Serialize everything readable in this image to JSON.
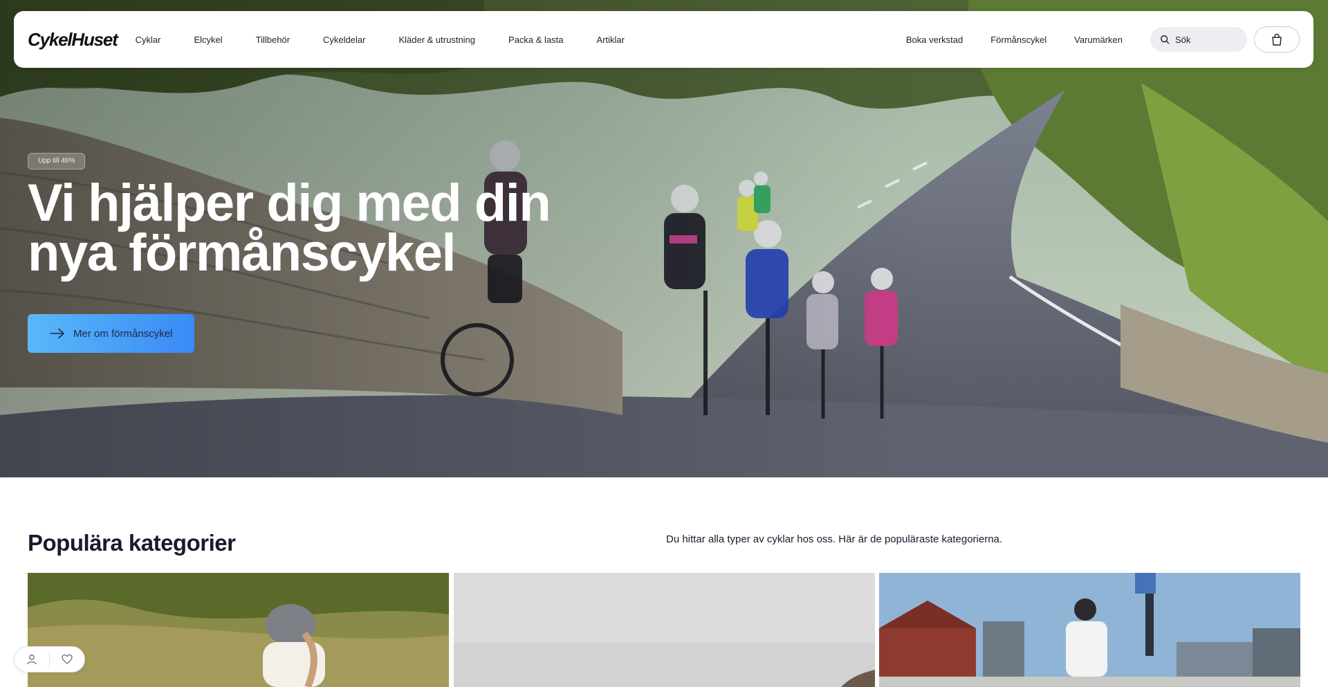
{
  "brand": {
    "logo": "CykelHuset"
  },
  "nav": {
    "main": [
      {
        "label": "Cyklar"
      },
      {
        "label": "Elcykel"
      },
      {
        "label": "Tillbehör"
      },
      {
        "label": "Cykeldelar"
      },
      {
        "label": "Kläder & utrustning"
      },
      {
        "label": "Packa & lasta"
      },
      {
        "label": "Artiklar"
      }
    ],
    "right": [
      {
        "label": "Boka verkstad"
      },
      {
        "label": "Förmånscykel"
      },
      {
        "label": "Varumärken"
      }
    ],
    "search_placeholder": "Sök",
    "icons": {
      "search": "search-icon",
      "cart": "shopping-bag-icon"
    }
  },
  "hero": {
    "badge": "Upp till 46%",
    "title": "Vi hjälper dig med din nya förmånscykel",
    "cta_label": "Mer om förmånscykel",
    "cta_icon": "arrow-right-icon",
    "image": "group of road cyclists riding uphill on a tree-lined road"
  },
  "categories": {
    "title": "Populära kategorier",
    "description": "Du hittar alla typer av cyklar hos oss. Här är de populäraste kategorierna.",
    "tiles": [
      {
        "image": "woman with helmet cycling through grassy field"
      },
      {
        "image": "grey overcast sky"
      },
      {
        "image": "man cycling in city by the harbor"
      }
    ]
  },
  "floatbar": {
    "icons": [
      "user-icon",
      "heart-icon"
    ]
  },
  "colors": {
    "cta_start": "#5ab8f8",
    "cta_end": "#3a8af5",
    "text_dark": "#1a1a2e",
    "search_bg": "#eceef1"
  }
}
